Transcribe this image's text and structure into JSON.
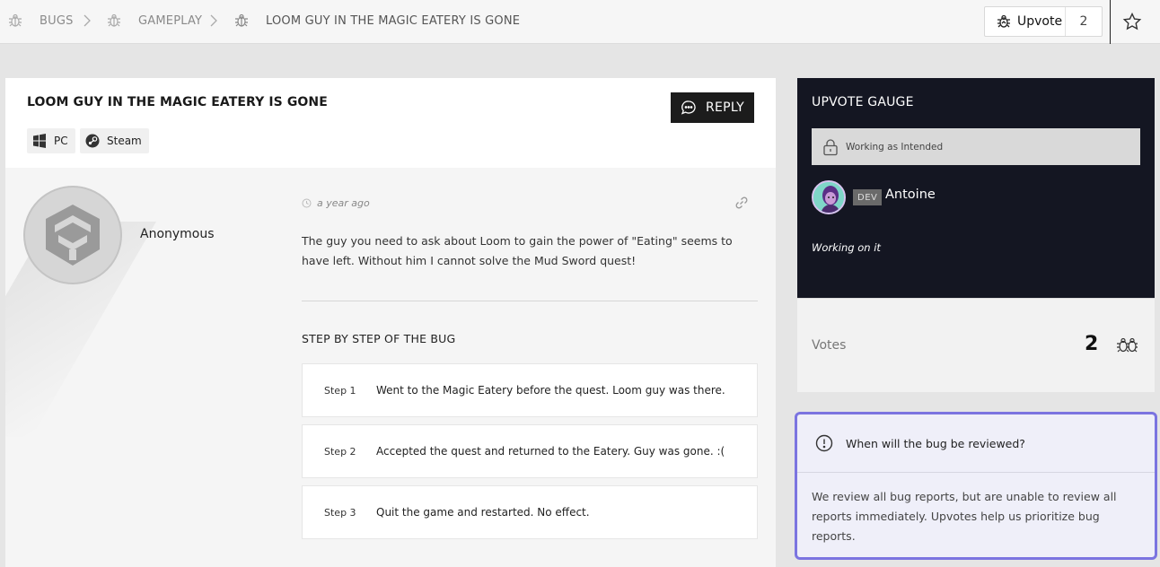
{
  "breadcrumb": {
    "items": [
      {
        "label": "BUGS",
        "icon": "bug-icon"
      },
      {
        "label": "GAMEPLAY",
        "icon": "bug-icon"
      },
      {
        "label": "LOOM GUY IN THE MAGIC EATERY IS GONE",
        "icon": "bug-icon"
      }
    ]
  },
  "toolbar": {
    "upvote_label": "Upvote",
    "upvote_count": "2",
    "favorite_icon": "star-icon"
  },
  "post": {
    "title": "LOOM GUY IN THE MAGIC EATERY IS GONE",
    "reply_label": "REPLY",
    "tags": [
      {
        "label": "PC",
        "icon": "windows-icon"
      },
      {
        "label": "Steam",
        "icon": "steam-icon"
      }
    ],
    "author": "Anonymous",
    "time": "a year ago",
    "body": "The guy you need to ask about Loom to gain the power of \"Eating\" seems to have left. Without him I cannot solve the Mud Sword quest!",
    "steps_heading": "STEP BY STEP OF THE BUG",
    "steps": [
      {
        "num": "Step 1",
        "text": "Went to the Magic Eatery before the quest. Loom guy was there."
      },
      {
        "num": "Step 2",
        "text": "Accepted the quest and returned to the Eatery. Guy was gone. :("
      },
      {
        "num": "Step 3",
        "text": "Quit the game and restarted. No effect."
      }
    ]
  },
  "gauge": {
    "title": "UPVOTE GAUGE",
    "status": "Working as Intended",
    "dev_badge": "DEV",
    "dev_name": "Antoine",
    "dev_note": "Working on it"
  },
  "votes": {
    "label": "Votes",
    "count": "2"
  },
  "faq": {
    "question": "When will the bug be reviewed?",
    "answer": "We review all bug reports, but are unable to review all reports immediately. Upvotes help us prioritize bug reports."
  },
  "colors": {
    "dark_panel": "#141622",
    "faq_border": "#7b74e0",
    "reply_bg": "#1c1c1c"
  }
}
